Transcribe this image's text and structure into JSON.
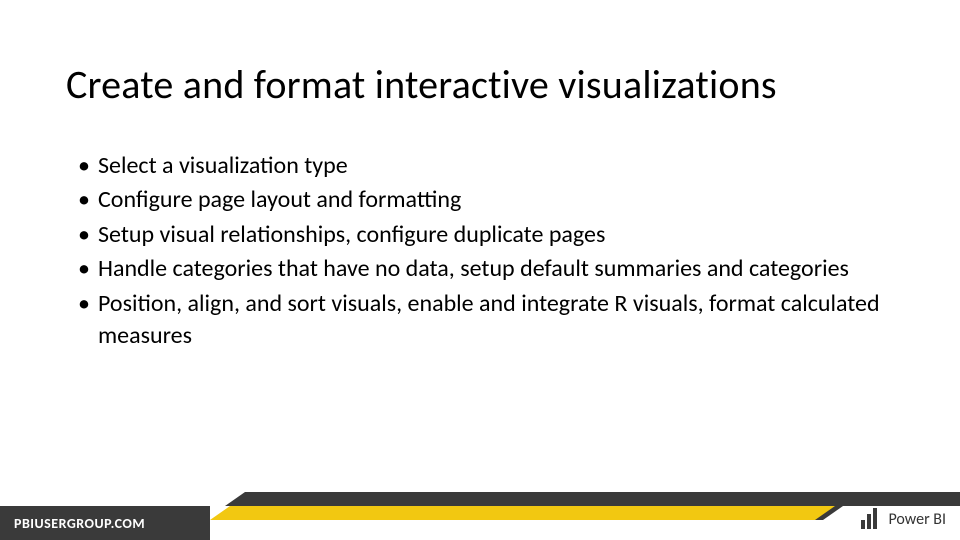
{
  "title": "Create and format interactive visualizations",
  "bullets": [
    "Select a visualization type",
    "Configure page layout and formatting",
    "Setup visual relationships, configure duplicate pages",
    "Handle categories that have no data, setup default summaries and categories",
    "Position, align, and sort visuals, enable and integrate R visuals, format calculated measures"
  ],
  "footer": {
    "site": "PBIUSERGROUP.COM",
    "brand": "Power BI"
  },
  "colors": {
    "accent": "#F2C811",
    "dark": "#3a3a3a"
  }
}
